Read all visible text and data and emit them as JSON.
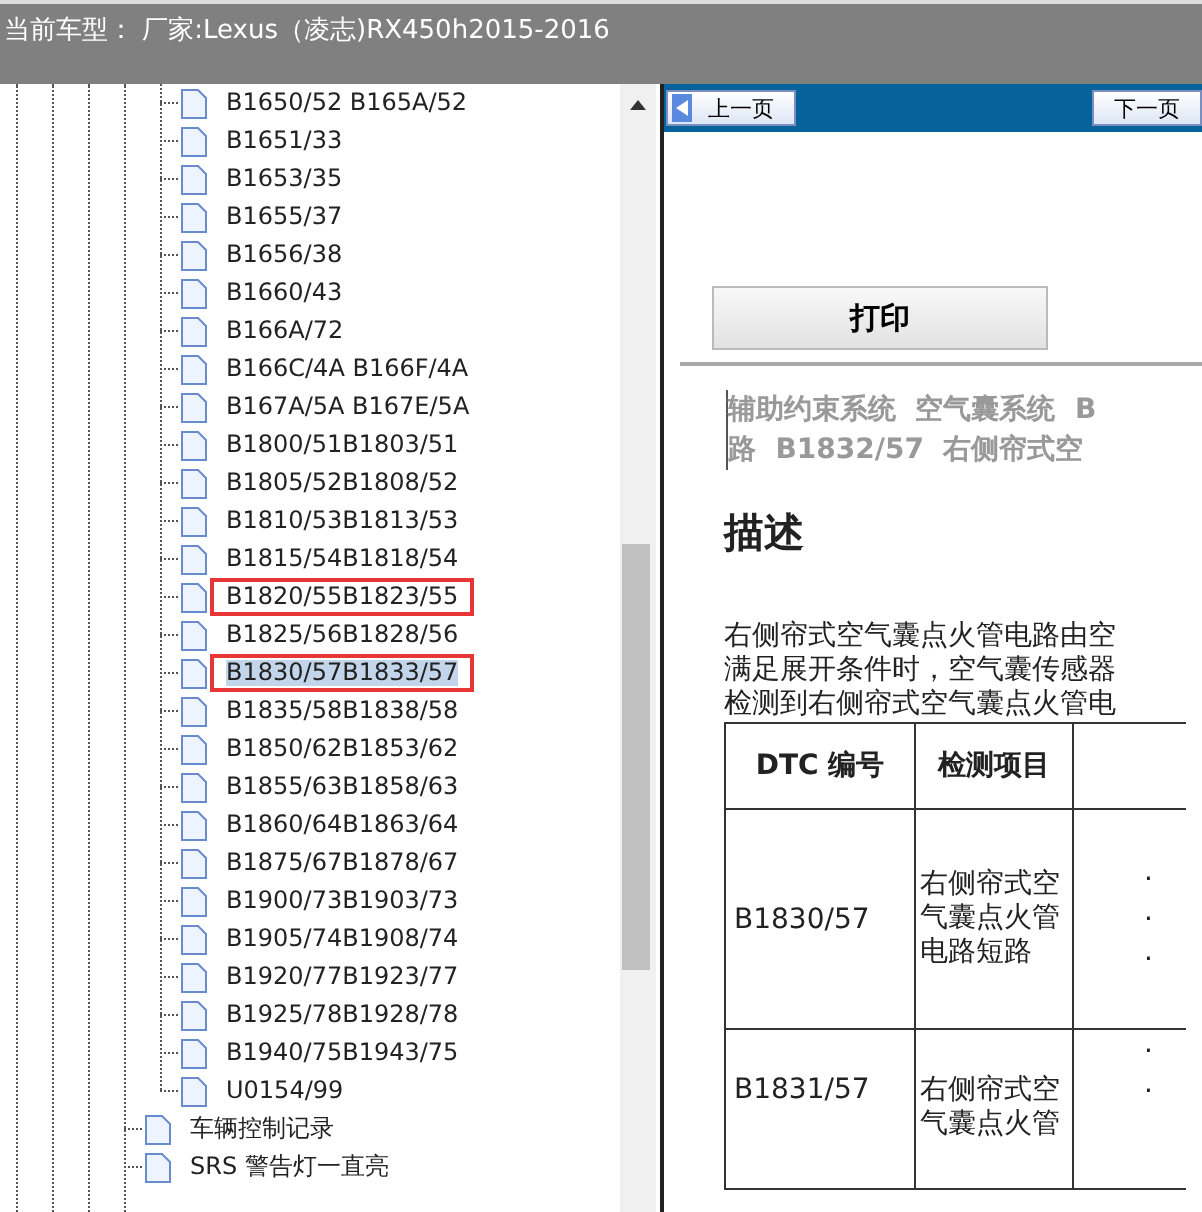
{
  "window": {
    "title": "当前车型：  厂家:Lexus（凌志)RX450h2015-2016"
  },
  "tree": [
    {
      "children": [
        {
          "label": "B1650/52 B165A/52",
          "selected": false,
          "marked": false
        },
        {
          "label": "B1651/33",
          "selected": false,
          "marked": false
        },
        {
          "label": "B1653/35",
          "selected": false,
          "marked": false
        },
        {
          "label": "B1655/37",
          "selected": false,
          "marked": false
        },
        {
          "label": "B1656/38",
          "selected": false,
          "marked": false
        },
        {
          "label": "B1660/43",
          "selected": false,
          "marked": false
        },
        {
          "label": "B166A/72",
          "selected": false,
          "marked": false
        },
        {
          "label": "B166C/4A B166F/4A",
          "selected": false,
          "marked": false
        },
        {
          "label": "B167A/5A B167E/5A",
          "selected": false,
          "marked": false
        },
        {
          "label": "B1800/51B1803/51",
          "selected": false,
          "marked": false
        },
        {
          "label": "B1805/52B1808/52",
          "selected": false,
          "marked": false
        },
        {
          "label": "B1810/53B1813/53",
          "selected": false,
          "marked": false
        },
        {
          "label": "B1815/54B1818/54",
          "selected": false,
          "marked": false
        },
        {
          "label": "B1820/55B1823/55",
          "selected": false,
          "marked": true
        },
        {
          "label": "B1825/56B1828/56",
          "selected": false,
          "marked": false
        },
        {
          "label": "B1830/57B1833/57",
          "selected": true,
          "marked": true
        },
        {
          "label": "B1835/58B1838/58",
          "selected": false,
          "marked": false
        },
        {
          "label": "B1850/62B1853/62",
          "selected": false,
          "marked": false
        },
        {
          "label": "B1855/63B1858/63",
          "selected": false,
          "marked": false
        },
        {
          "label": "B1860/64B1863/64",
          "selected": false,
          "marked": false
        },
        {
          "label": "B1875/67B1878/67",
          "selected": false,
          "marked": false
        },
        {
          "label": "B1900/73B1903/73",
          "selected": false,
          "marked": false
        },
        {
          "label": "B1905/74B1908/74",
          "selected": false,
          "marked": false
        },
        {
          "label": "B1920/77B1923/77",
          "selected": false,
          "marked": false
        },
        {
          "label": "B1925/78B1928/78",
          "selected": false,
          "marked": false
        },
        {
          "label": "B1940/75B1943/75",
          "selected": false,
          "marked": false
        },
        {
          "label": "U0154/99",
          "selected": false,
          "marked": false
        }
      ]
    },
    {
      "label": "车辆控制记录",
      "selected": false,
      "marked": false
    },
    {
      "label": "SRS 警告灯一直亮",
      "selected": false,
      "marked": false
    }
  ],
  "viewer": {
    "prev_button": "上一页",
    "next_button": "下一页",
    "print_button": "打印",
    "breadcrumb": [
      "辅助约束系统  空气囊系统  B",
      "路  B1832/57  右侧帘式空"
    ],
    "heading": "描述",
    "paragraph": [
      "右侧帘式空气囊点火管电路由空",
      "满足展开条件时，空气囊传感器",
      "检测到右侧帘式空气囊点火管电"
    ],
    "table": {
      "columns": [
        "DTC 编号",
        "检测项目"
      ],
      "rows": [
        {
          "code": "B1830/57",
          "item": "右侧帘式空气囊点火管电路短路",
          "column_3": [
            "·",
            "·",
            "·"
          ]
        },
        {
          "code": "B1831/57",
          "item": "右侧帘式空气囊点火管",
          "column_3": [
            "·",
            "·"
          ]
        }
      ]
    }
  }
}
